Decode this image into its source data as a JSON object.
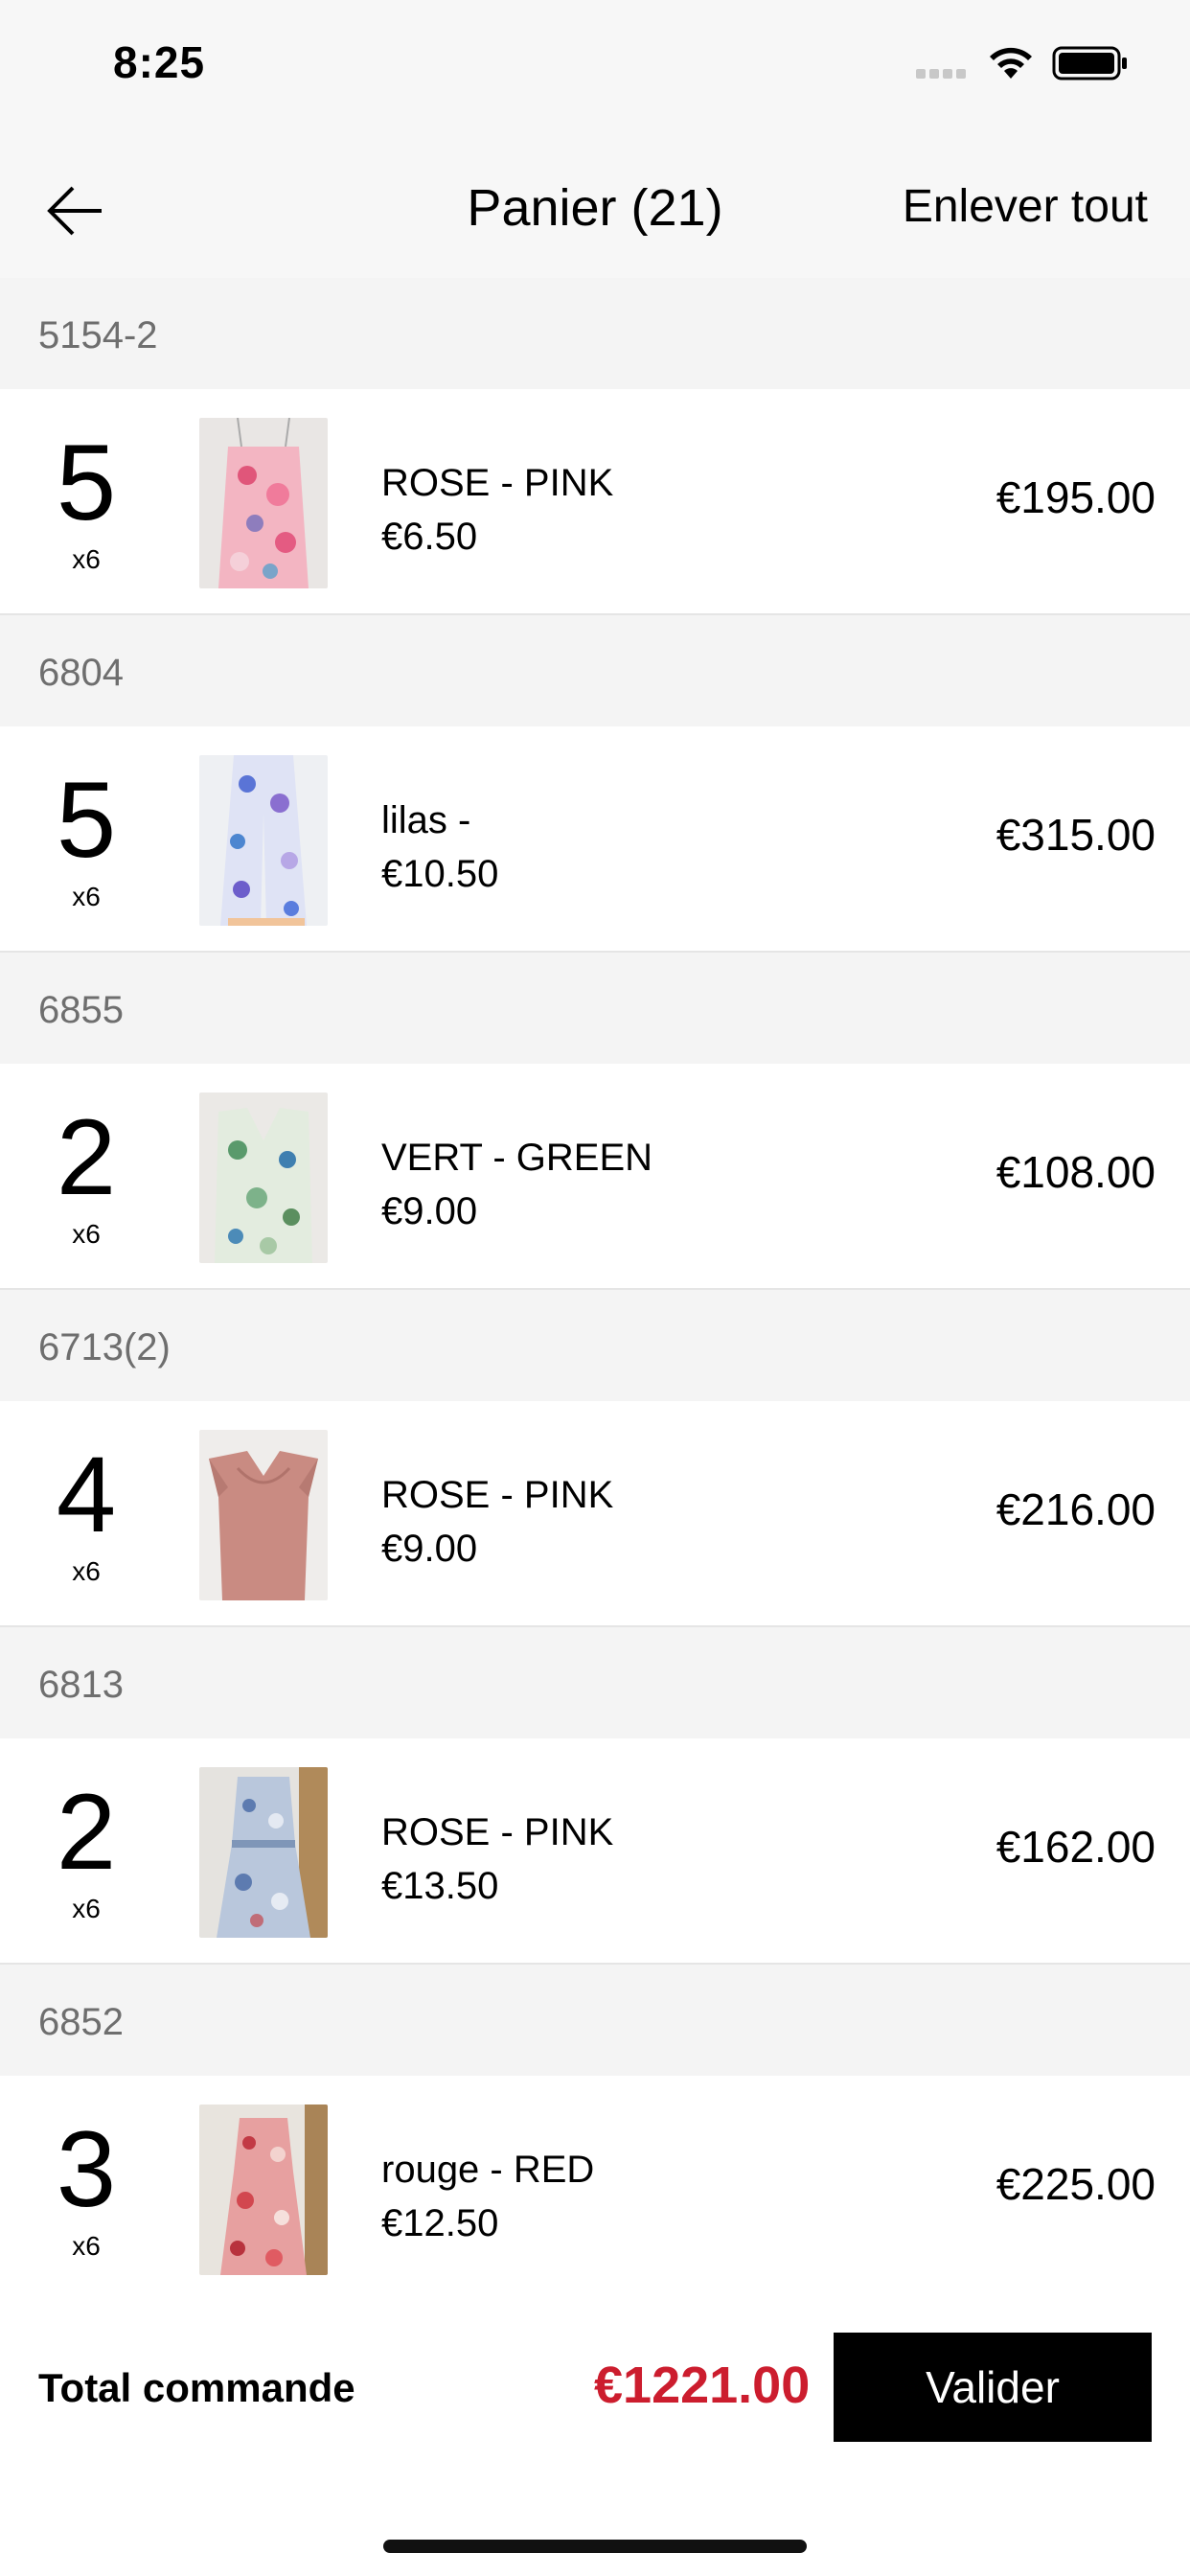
{
  "status_bar": {
    "time": "8:25"
  },
  "nav": {
    "title": "Panier (21)",
    "clear_all": "Enlever tout"
  },
  "sections": [
    {
      "ref": "5154-2",
      "qty": "5",
      "pack": "x6",
      "color_label": "ROSE - PINK",
      "unit_price": "€6.50",
      "total": "€195.00",
      "thumb": "pink-floral-camisole"
    },
    {
      "ref": "6804",
      "qty": "5",
      "pack": "x6",
      "color_label": "lilas -",
      "unit_price": "€10.50",
      "total": "€315.00",
      "thumb": "lilac-floral-pants"
    },
    {
      "ref": "6855",
      "qty": "2",
      "pack": "x6",
      "color_label": "VERT - GREEN",
      "unit_price": "€9.00",
      "total": "€108.00",
      "thumb": "green-floral-top"
    },
    {
      "ref": "6713(2)",
      "qty": "4",
      "pack": "x6",
      "color_label": "ROSE - PINK",
      "unit_price": "€9.00",
      "total": "€216.00",
      "thumb": "pink-ruffle-top"
    },
    {
      "ref": "6813",
      "qty": "2",
      "pack": "x6",
      "color_label": "ROSE - PINK",
      "unit_price": "€13.50",
      "total": "€162.00",
      "thumb": "blue-floral-dress"
    },
    {
      "ref": "6852",
      "qty": "3",
      "pack": "x6",
      "color_label": "rouge - RED",
      "unit_price": "€12.50",
      "total": "€225.00",
      "thumb": "red-floral-dress"
    }
  ],
  "footer": {
    "total_label": "Total commande",
    "total_value": "€1221.00",
    "validate_label": "Valider"
  },
  "colors": {
    "accent_red": "#cc1d2e",
    "button_bg": "#000000"
  }
}
